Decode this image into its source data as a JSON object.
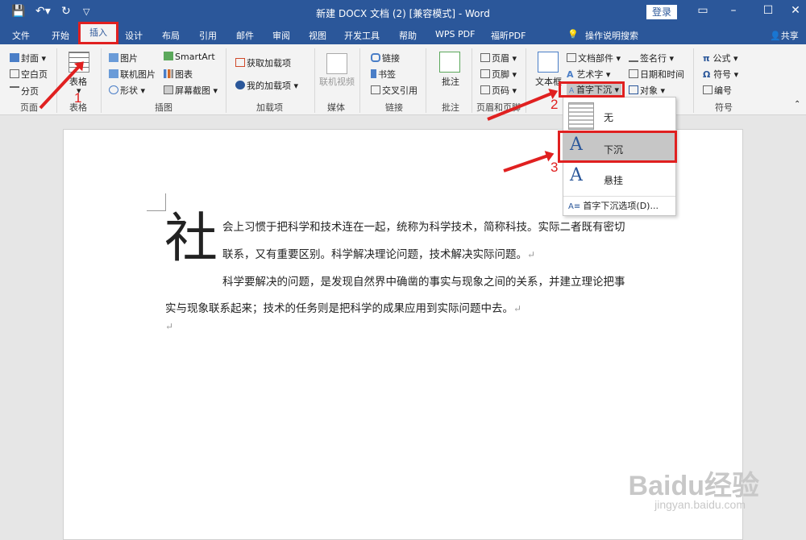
{
  "window": {
    "title": "新建 DOCX 文档 (2) [兼容模式] - Word",
    "login": "登录",
    "share": "共享",
    "accent": "#2b579a"
  },
  "tabs": [
    "文件",
    "开始",
    "插入",
    "设计",
    "布局",
    "引用",
    "邮件",
    "审阅",
    "视图",
    "开发工具",
    "帮助",
    "WPS PDF",
    "福昕PDF"
  ],
  "tell_me": "操作说明搜索",
  "ribbon": {
    "pages": {
      "cover": "封面",
      "blank": "空白页",
      "break": "分页",
      "group": "页面"
    },
    "tables": {
      "table": "表格",
      "group": "表格"
    },
    "illustrations": {
      "pictures": "图片",
      "online_pictures": "联机图片",
      "shapes": "形状",
      "smartart": "SmartArt",
      "chart": "图表",
      "screenshot": "屏幕截图",
      "group": "插图"
    },
    "addins": {
      "get": "获取加载项",
      "my": "我的加载项",
      "group": "加载项"
    },
    "media": {
      "online_video": "联机视频",
      "group": "媒体"
    },
    "links": {
      "link": "链接",
      "bookmark": "书签",
      "cross_ref": "交叉引用",
      "group": "链接"
    },
    "comments": {
      "comment": "批注",
      "group": "批注"
    },
    "header_footer": {
      "header": "页眉",
      "footer": "页脚",
      "page_number": "页码",
      "group": "页眉和页脚"
    },
    "text": {
      "textbox": "文本框",
      "quick_parts": "文档部件",
      "wordart": "艺术字",
      "drop_cap": "首字下沉",
      "signature": "签名行",
      "datetime": "日期和时间",
      "object": "对象"
    },
    "symbols": {
      "equation": "公式",
      "symbol": "符号",
      "number": "编号",
      "group": "符号"
    }
  },
  "dropdown": {
    "items": [
      "无",
      "下沉",
      "悬挂"
    ],
    "options": "首字下沉选项(D)..."
  },
  "annotations": [
    "1",
    "2",
    "3"
  ],
  "document": {
    "dropcap": "社",
    "line1": "会上习惯于把科学和技术连在一起，统称为科学技术，简称科技。实际二者既有密切",
    "line2": "联系，又有重要区别。科学解决理论问题，技术解决实际问题。",
    "line3": "科学要解决的问题，是发现自然界中确凿的事实与现象之间的关系，并建立理论把事",
    "line4": "实与现象联系起来；技术的任务则是把科学的成果应用到实际问题中去。",
    "para_mark": "↵"
  },
  "watermark": {
    "main": "Baidu经验",
    "sub": "jingyan.baidu.com"
  }
}
